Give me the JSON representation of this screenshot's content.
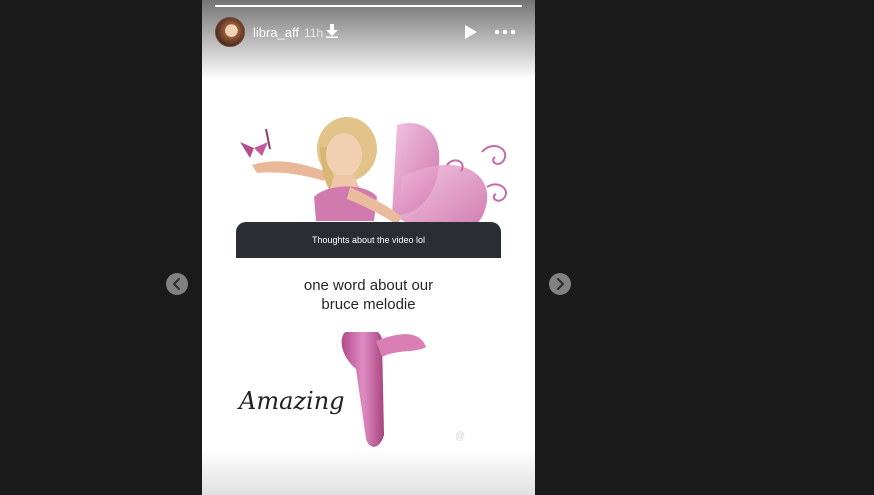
{
  "story": {
    "username": "libra_aff",
    "time": "11h",
    "progress": 1.0,
    "icons": [
      "avatar",
      "download-icon",
      "play-icon",
      "more-options-icon",
      "chevron-left-icon",
      "chevron-right-icon"
    ]
  },
  "question_sticker": {
    "prompt": "Thoughts about the video lol",
    "answer_line1": "one word about our",
    "answer_line2": "bruce melodie"
  },
  "overlay_text": "Amazing",
  "colors": {
    "background": "#1a1a1a",
    "sticker_header": "#2a2d33",
    "fairy_pink": "#d278b4"
  }
}
